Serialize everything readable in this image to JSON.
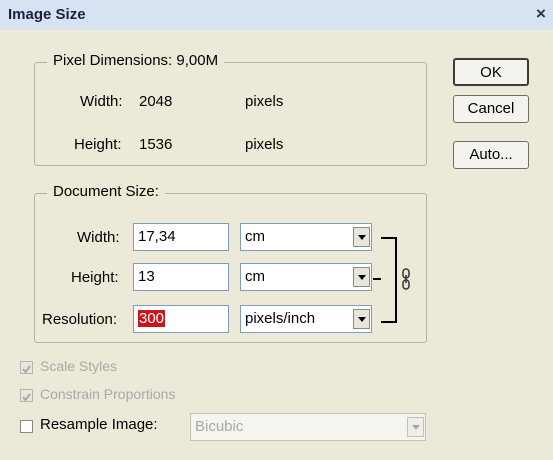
{
  "window": {
    "title": "Image Size",
    "close_glyph": "×"
  },
  "pixel_dimensions": {
    "legend": "Pixel Dimensions:",
    "size": "9,00M",
    "width_label": "Width:",
    "width_value": "2048",
    "width_unit": "pixels",
    "height_label": "Height:",
    "height_value": "1536",
    "height_unit": "pixels"
  },
  "document_size": {
    "legend": "Document Size:",
    "width_label": "Width:",
    "width_value": "17,34",
    "width_unit": "cm",
    "height_label": "Height:",
    "height_value": "13",
    "height_unit": "cm",
    "resolution_label": "Resolution:",
    "resolution_value": "300",
    "resolution_unit": "pixels/inch"
  },
  "buttons": {
    "ok": "OK",
    "cancel": "Cancel",
    "auto": "Auto..."
  },
  "options": {
    "scale_styles": {
      "label": "Scale Styles",
      "checked": true,
      "enabled": false
    },
    "constrain_proportions": {
      "label": "Constrain Proportions",
      "checked": true,
      "enabled": false
    },
    "resample_image": {
      "label": "Resample Image:",
      "checked": false,
      "enabled": true,
      "method": "Bicubic",
      "method_enabled": false
    }
  },
  "icons": {
    "chain_link": "chain-link-icon",
    "dropdown_arrow": "chevron-down-icon"
  },
  "colors": {
    "title_bar": "#d7e3f3",
    "dialog_bg": "#ece9d8",
    "selection_highlight": "#c8161d"
  }
}
